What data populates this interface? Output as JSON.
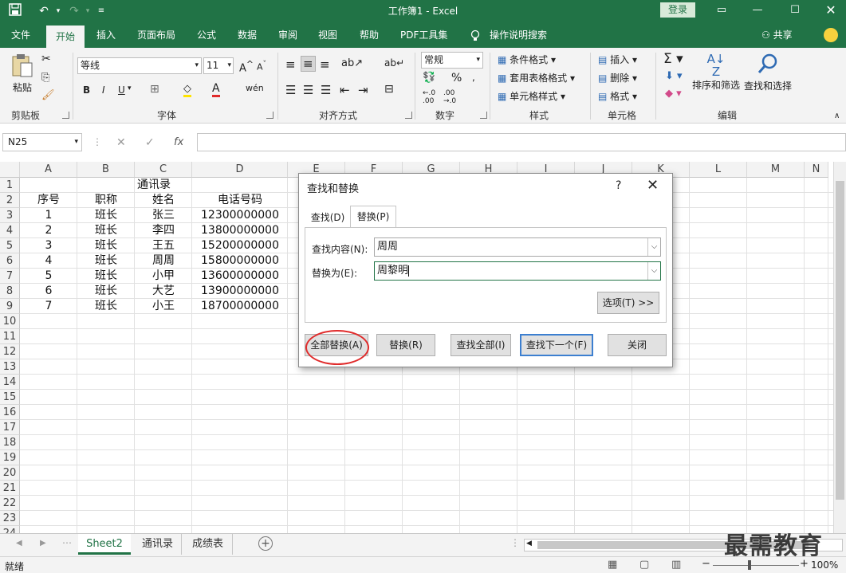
{
  "window": {
    "title": "工作簿1 - Excel",
    "login_label": "登录"
  },
  "ribbon": {
    "tabs": [
      "文件",
      "开始",
      "插入",
      "页面布局",
      "公式",
      "数据",
      "审阅",
      "视图",
      "帮助",
      "PDF工具集",
      "操作说明搜索"
    ],
    "active_tab": "开始",
    "share_label": "共享",
    "groups": {
      "clipboard": {
        "label": "剪贴板",
        "paste": "粘贴"
      },
      "font": {
        "label": "字体",
        "font_name": "等线",
        "font_size": "11",
        "bold": "B",
        "italic": "I",
        "underline": "U"
      },
      "alignment": {
        "label": "对齐方式"
      },
      "number": {
        "label": "数字",
        "format": "常规",
        "percent": "%"
      },
      "styles": {
        "label": "样式",
        "conditional": "条件格式",
        "table": "套用表格格式",
        "cell_styles": "单元格样式"
      },
      "cells": {
        "label": "单元格",
        "insert": "插入",
        "delete": "删除",
        "format": "格式"
      },
      "editing": {
        "label": "编辑",
        "sort_filter": "排序和筛选",
        "find_select": "查找和选择"
      }
    }
  },
  "formula_bar": {
    "name_box": "N25",
    "cancel_glyph": "✕",
    "enter_glyph": "✓",
    "fx": "fx",
    "value": ""
  },
  "sheet": {
    "columns": [
      "A",
      "B",
      "C",
      "D",
      "E",
      "F",
      "G",
      "H",
      "I",
      "J",
      "K",
      "L",
      "M",
      "N"
    ],
    "rows": [
      "1",
      "2",
      "3",
      "4",
      "5",
      "6",
      "7",
      "8",
      "9",
      "10",
      "11",
      "12",
      "13",
      "14",
      "15",
      "16",
      "17",
      "18",
      "19",
      "20",
      "21",
      "22",
      "23",
      "24"
    ],
    "title": "通讯录",
    "headers": [
      "序号",
      "职称",
      "姓名",
      "电话号码"
    ],
    "records": [
      [
        "1",
        "班长",
        "张三",
        "12300000000"
      ],
      [
        "2",
        "班长",
        "李四",
        "13800000000"
      ],
      [
        "3",
        "班长",
        "王五",
        "15200000000"
      ],
      [
        "4",
        "班长",
        "周周",
        "15800000000"
      ],
      [
        "5",
        "班长",
        "小甲",
        "13600000000"
      ],
      [
        "6",
        "班长",
        "大艺",
        "13900000000"
      ],
      [
        "7",
        "班长",
        "小王",
        "18700000000"
      ]
    ]
  },
  "sheet_tabs": [
    "Sheet2",
    "通讯录",
    "成绩表"
  ],
  "active_sheet": "Sheet2",
  "status": {
    "mode": "就绪",
    "zoom": "100%"
  },
  "dialog": {
    "title": "查找和替换",
    "help": "?",
    "close": "✕",
    "tabs": [
      "查找(D)",
      "替换(P)"
    ],
    "active_tab": "替换(P)",
    "find_label": "查找内容(N):",
    "find_value": "周周",
    "replace_label": "替换为(E):",
    "replace_value": "周黎明",
    "options_button": "选项(T) >>",
    "buttons": {
      "replace_all": "全部替换(A)",
      "replace": "替换(R)",
      "find_all": "查找全部(I)",
      "find_next": "查找下一个(F)",
      "close": "关闭"
    }
  },
  "watermark": "最需教育",
  "colors": {
    "excel_green": "#217346",
    "highlight": "#e02b2b"
  }
}
